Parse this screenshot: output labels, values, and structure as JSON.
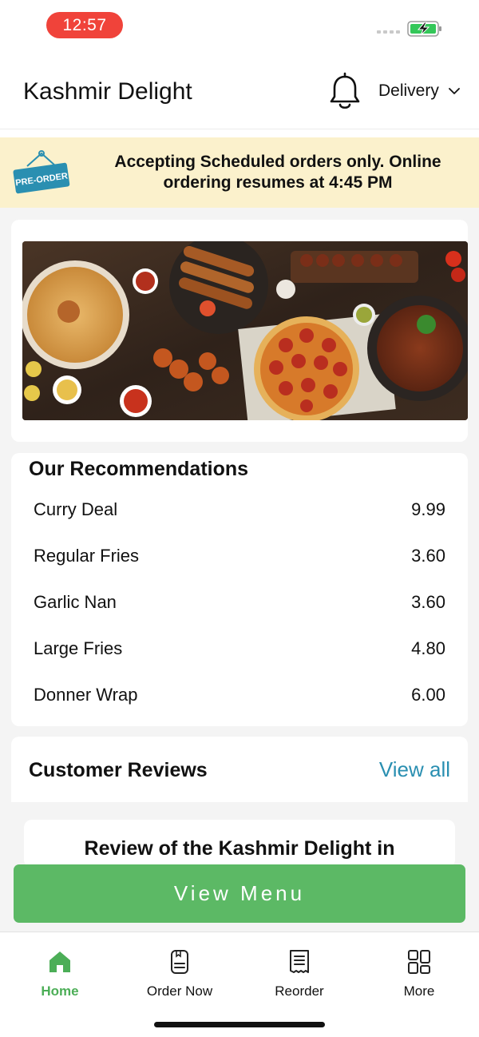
{
  "status_bar": {
    "time": "12:57"
  },
  "header": {
    "title": "Kashmir Delight",
    "mode": "Delivery"
  },
  "banner": {
    "badge": "PRE-ORDER",
    "message": "Accepting Scheduled orders only. Online ordering resumes at 4:45 PM"
  },
  "recommendations": {
    "title": "Our Recommendations",
    "items": [
      {
        "name": "Curry Deal",
        "price": "9.99"
      },
      {
        "name": "Regular Fries",
        "price": "3.60"
      },
      {
        "name": "Garlic Nan",
        "price": "3.60"
      },
      {
        "name": "Large Fries",
        "price": "4.80"
      },
      {
        "name": "Donner Wrap",
        "price": "6.00"
      }
    ]
  },
  "reviews": {
    "title": "Customer Reviews",
    "view_all": "View all",
    "first_review_title": "Review of the Kashmir Delight in"
  },
  "cta": {
    "label": "View Menu"
  },
  "tabs": [
    {
      "label": "Home",
      "icon": "home-icon",
      "active": true
    },
    {
      "label": "Order Now",
      "icon": "order-icon",
      "active": false
    },
    {
      "label": "Reorder",
      "icon": "receipt-icon",
      "active": false
    },
    {
      "label": "More",
      "icon": "grid-icon",
      "active": false
    }
  ],
  "colors": {
    "accent_green": "#5cb965",
    "link_blue": "#2a8fb1",
    "banner_bg": "#fbf1cc",
    "time_pill": "#f0433a",
    "badge_blue": "#2a8fb1"
  }
}
